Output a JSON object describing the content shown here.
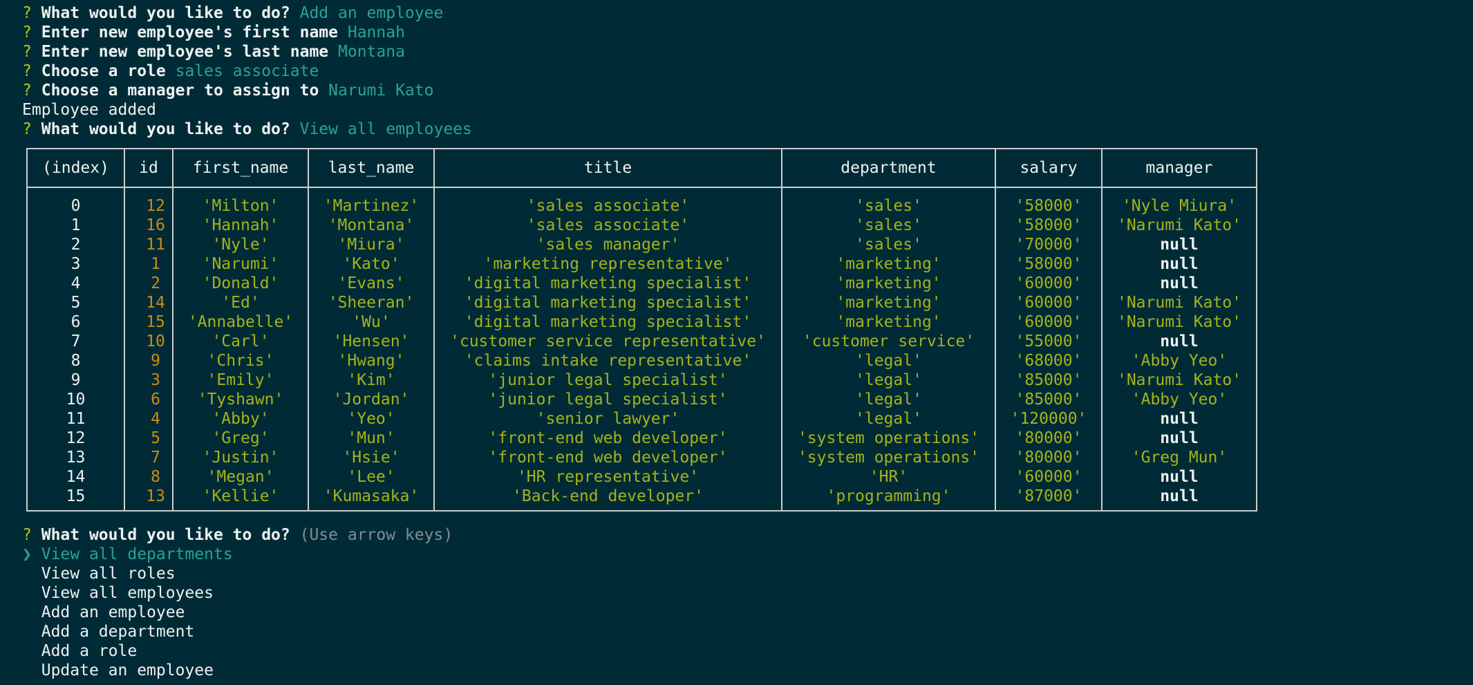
{
  "prompts": [
    {
      "mark": "?",
      "question": "What would you like to do?",
      "answer": "Add an employee"
    },
    {
      "mark": "?",
      "question": "Enter new employee's first name",
      "answer": "Hannah"
    },
    {
      "mark": "?",
      "question": "Enter new employee's last name",
      "answer": "Montana"
    },
    {
      "mark": "?",
      "question": "Choose a role",
      "answer": "sales associate"
    },
    {
      "mark": "?",
      "question": "Choose a manager to assign to",
      "answer": "Narumi Kato"
    }
  ],
  "status_message": "Employee added",
  "view_prompt": {
    "mark": "?",
    "question": "What would you like to do?",
    "answer": "View all employees"
  },
  "table": {
    "columns": [
      "(index)",
      "id",
      "first_name",
      "last_name",
      "title",
      "department",
      "salary",
      "manager"
    ],
    "rows": [
      [
        "0",
        "12",
        "'Milton'",
        "'Martinez'",
        "'sales associate'",
        "'sales'",
        "'58000'",
        "'Nyle Miura'"
      ],
      [
        "1",
        "16",
        "'Hannah'",
        "'Montana'",
        "'sales associate'",
        "'sales'",
        "'58000'",
        "'Narumi Kato'"
      ],
      [
        "2",
        "11",
        "'Nyle'",
        "'Miura'",
        "'sales manager'",
        "'sales'",
        "'70000'",
        "null"
      ],
      [
        "3",
        "1",
        "'Narumi'",
        "'Kato'",
        "'marketing representative'",
        "'marketing'",
        "'58000'",
        "null"
      ],
      [
        "4",
        "2",
        "'Donald'",
        "'Evans'",
        "'digital marketing specialist'",
        "'marketing'",
        "'60000'",
        "null"
      ],
      [
        "5",
        "14",
        "'Ed'",
        "'Sheeran'",
        "'digital marketing specialist'",
        "'marketing'",
        "'60000'",
        "'Narumi Kato'"
      ],
      [
        "6",
        "15",
        "'Annabelle'",
        "'Wu'",
        "'digital marketing specialist'",
        "'marketing'",
        "'60000'",
        "'Narumi Kato'"
      ],
      [
        "7",
        "10",
        "'Carl'",
        "'Hensen'",
        "'customer service representative'",
        "'customer service'",
        "'55000'",
        "null"
      ],
      [
        "8",
        "9",
        "'Chris'",
        "'Hwang'",
        "'claims intake representative'",
        "'legal'",
        "'68000'",
        "'Abby Yeo'"
      ],
      [
        "9",
        "3",
        "'Emily'",
        "'Kim'",
        "'junior legal specialist'",
        "'legal'",
        "'85000'",
        "'Narumi Kato'"
      ],
      [
        "10",
        "6",
        "'Tyshawn'",
        "'Jordan'",
        "'junior legal specialist'",
        "'legal'",
        "'85000'",
        "'Abby Yeo'"
      ],
      [
        "11",
        "4",
        "'Abby'",
        "'Yeo'",
        "'senior lawyer'",
        "'legal'",
        "'120000'",
        "null"
      ],
      [
        "12",
        "5",
        "'Greg'",
        "'Mun'",
        "'front-end web developer'",
        "'system operations'",
        "'80000'",
        "null"
      ],
      [
        "13",
        "7",
        "'Justin'",
        "'Hsie'",
        "'front-end web developer'",
        "'system operations'",
        "'80000'",
        "'Greg Mun'"
      ],
      [
        "14",
        "8",
        "'Megan'",
        "'Lee'",
        "'HR representative'",
        "'HR'",
        "'60000'",
        "null"
      ],
      [
        "15",
        "13",
        "'Kellie'",
        "'Kumasaka'",
        "'Back-end developer'",
        "'programming'",
        "'87000'",
        "null"
      ]
    ]
  },
  "menu_prompt": {
    "mark": "?",
    "question": "What would you like to do?",
    "hint": "(Use arrow keys)"
  },
  "menu": {
    "pointer": "❯",
    "selected_index": 0,
    "items": [
      "View all departments",
      "View all roles",
      "View all employees",
      "Add an employee",
      "Add a department",
      "Add a role",
      "Update an employee"
    ]
  },
  "colors": {
    "background": "#002b36",
    "question_mark": "#b5c61a",
    "answer": "#2aa198",
    "string_value": "#a4b31a",
    "number_value": "#cb8a12",
    "text": "#eef1f1"
  }
}
